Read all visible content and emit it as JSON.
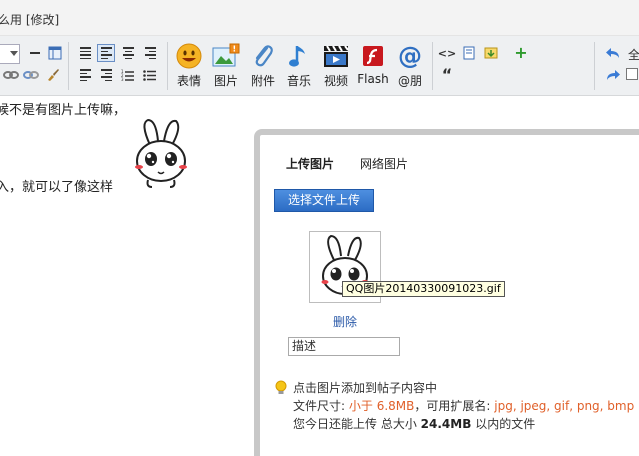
{
  "title": "么用 [修改]",
  "toolbar": {
    "buttons": [
      {
        "label": "表情"
      },
      {
        "label": "图片"
      },
      {
        "label": "附件"
      },
      {
        "label": "音乐"
      },
      {
        "label": "视频"
      },
      {
        "label": "Flash"
      },
      {
        "label": "@朋"
      }
    ],
    "quote_glyph": "“",
    "code_glyph": "<>",
    "right_labels": [
      "全",
      "□"
    ]
  },
  "editor": {
    "line1": "候不是有图片上传嘛，",
    "line2": "入，就可以了像这样"
  },
  "upload": {
    "tabs": [
      {
        "label": "上传图片",
        "active": true
      },
      {
        "label": "网络图片",
        "active": false
      }
    ],
    "select_button": "选择文件上传",
    "file_name": "QQ图片20140330091023.gif",
    "delete_label": "删除",
    "description_value": "描述",
    "info": {
      "line1": "点击图片添加到帖子内容中",
      "size_prefix": "文件尺寸:",
      "size_value": "小于 6.8MB",
      "ext_prefix": "，可用扩展名:",
      "ext_value": "jpg, jpeg, gif, png, bmp",
      "today_prefix": "您今日还能上传 总大小",
      "today_value": "24.4MB",
      "today_suffix": "以内的文件"
    }
  },
  "colors": {
    "accent_blue": "#2c6cc4",
    "link_blue": "#2a59a8",
    "highlight_orange": "#e0602a",
    "dialog_border": "#c8c8c8"
  }
}
